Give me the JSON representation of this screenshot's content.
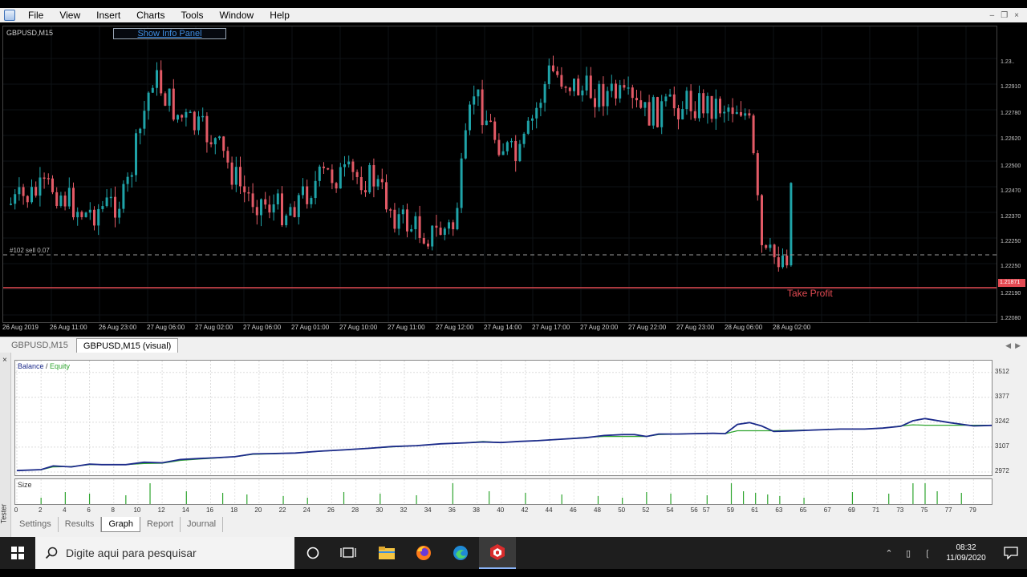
{
  "menu": {
    "items": [
      "File",
      "View",
      "Insert",
      "Charts",
      "Tools",
      "Window",
      "Help"
    ]
  },
  "chart": {
    "symbol_label": "GBPUSD,M15",
    "info_panel_button": "Show Info Panel",
    "order_label": "#102 sell 0.07",
    "take_profit_label": "Take Profit",
    "price_labels": [
      "1.23..",
      "1.22910",
      "1.22780",
      "1.22620",
      "1.22500",
      "1.22470",
      "1.22370",
      "1.22250",
      "1.22250",
      "1.22190",
      "1.22080"
    ],
    "price_marker": "1.21871",
    "time_labels": [
      "26 Aug 2019",
      "26 Aug 11:00",
      "26 Aug 23:00",
      "27 Aug 06:00",
      "27 Aug 02:00",
      "27 Aug 06:00",
      "27 Aug 01:00",
      "27 Aug 10:00",
      "27 Aug 11:00",
      "27 Aug 12:00",
      "27 Aug 14:00",
      "27 Aug 17:00",
      "27 Aug 20:00",
      "27 Aug 22:00",
      "27 Aug 23:00",
      "28 Aug 06:00",
      "28 Aug 02:00"
    ]
  },
  "chart_tabs": [
    "GBPUSD,M15",
    "GBPUSD,M15 (visual)"
  ],
  "tester": {
    "side_label": "Tester",
    "close_icon": "×",
    "legend_balance": "Balance",
    "legend_sep": " / ",
    "legend_equity": "Equity",
    "size_label": "Size",
    "tabs": [
      "Settings",
      "Results",
      "Graph",
      "Report",
      "Journal"
    ],
    "active_tab": "Graph"
  },
  "chart_data": {
    "type": "line",
    "ylim": [
      2972,
      3550
    ],
    "y_ticks": [
      3512,
      3377,
      3242,
      3107,
      2972
    ],
    "x_ticks": [
      0,
      2,
      4,
      6,
      8,
      10,
      12,
      14,
      16,
      18,
      20,
      22,
      24,
      26,
      28,
      30,
      32,
      34,
      36,
      38,
      40,
      42,
      44,
      46,
      48,
      50,
      52,
      54,
      56,
      57,
      59,
      61,
      63,
      65,
      67,
      69,
      71,
      73,
      75,
      77,
      79
    ],
    "xlim": [
      0,
      80.5
    ],
    "series": [
      {
        "name": "Balance",
        "color": "#1b2a8a",
        "x": [
          0,
          2,
          3,
          4.5,
          6,
          7,
          9,
          10.5,
          12,
          13.5,
          15,
          16.5,
          18,
          19.5,
          21,
          23,
          25,
          27,
          29,
          31,
          33,
          35,
          37,
          38.5,
          40,
          41.5,
          43,
          45,
          47,
          48.5,
          50,
          51,
          52,
          53,
          54.5,
          56,
          57.5,
          58.5,
          59.5,
          60.5,
          61.5,
          62.5,
          64,
          66,
          68,
          70,
          71.5,
          73,
          74,
          75,
          77,
          79,
          80.5
        ],
        "y": [
          2980,
          2985,
          3005,
          3000,
          3015,
          3012,
          3012,
          3025,
          3022,
          3040,
          3045,
          3050,
          3055,
          3070,
          3072,
          3075,
          3085,
          3092,
          3100,
          3110,
          3115,
          3125,
          3130,
          3135,
          3132,
          3138,
          3142,
          3150,
          3158,
          3170,
          3175,
          3175,
          3165,
          3178,
          3178,
          3180,
          3182,
          3180,
          3230,
          3240,
          3222,
          3192,
          3195,
          3200,
          3205,
          3205,
          3210,
          3220,
          3250,
          3262,
          3240,
          3222,
          3225
        ]
      },
      {
        "name": "Equity",
        "color": "#2fa52f",
        "x": [
          0,
          2,
          3,
          4.5,
          6,
          7,
          9,
          10.5,
          12,
          13.5,
          15,
          16.5,
          18,
          19.5,
          21,
          23,
          25,
          27,
          29,
          31,
          33,
          35,
          37,
          38.5,
          40,
          41.5,
          43,
          45,
          47,
          48.5,
          50,
          51,
          52,
          53,
          54.5,
          56,
          57.5,
          58.5,
          59.5,
          60.5,
          61.5,
          62.5,
          64,
          66,
          68,
          70,
          71.5,
          73,
          74,
          75,
          77,
          79,
          80.5
        ],
        "y": [
          2980,
          2984,
          3000,
          3002,
          3012,
          3012,
          3012,
          3018,
          3020,
          3035,
          3042,
          3048,
          3055,
          3068,
          3070,
          3075,
          3084,
          3092,
          3100,
          3108,
          3115,
          3125,
          3130,
          3138,
          3132,
          3138,
          3142,
          3150,
          3160,
          3165,
          3165,
          3165,
          3165,
          3175,
          3177,
          3180,
          3182,
          3180,
          3196,
          3196,
          3196,
          3196,
          3198,
          3200,
          3205,
          3205,
          3210,
          3222,
          3228,
          3226,
          3226,
          3226,
          3226
        ]
      }
    ],
    "size_bars": [
      2,
      4,
      6,
      9,
      11,
      14,
      17,
      19,
      22,
      24,
      27,
      30,
      33,
      36,
      39,
      42,
      45,
      48,
      50,
      52,
      54,
      57,
      59,
      60,
      61,
      62,
      63,
      65,
      69,
      72,
      74,
      75,
      76,
      78
    ]
  },
  "taskbar": {
    "search_placeholder": "Digite aqui para pesquisar",
    "time": "08:32",
    "date": "11/09/2020"
  }
}
